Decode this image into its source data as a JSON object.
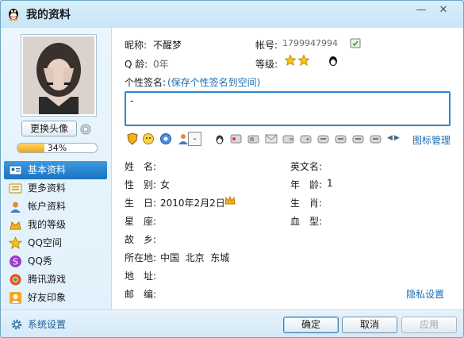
{
  "window": {
    "title": "我的资料",
    "minimize": "—",
    "close": "✕"
  },
  "avatar": {
    "change_label": "更换头像",
    "progress_percent": 34,
    "progress_label": "34%"
  },
  "nav": [
    {
      "label": "基本资料",
      "icon": "basic-profile-icon",
      "active": true
    },
    {
      "label": "更多资料",
      "icon": "more-profile-icon"
    },
    {
      "label": "帐户资料",
      "icon": "account-icon"
    },
    {
      "label": "我的等级",
      "icon": "level-icon"
    },
    {
      "label": "QQ空间",
      "icon": "qzone-icon"
    },
    {
      "label": "QQ秀",
      "icon": "qqshow-icon"
    },
    {
      "label": "腾讯游戏",
      "icon": "game-icon"
    },
    {
      "label": "好友印象",
      "icon": "impression-icon"
    }
  ],
  "profile": {
    "nickname_label": "昵称:",
    "nickname": "不醒梦",
    "account_label": "帐号:",
    "account": "1799947994",
    "qage_label": "Q 龄:",
    "qage": "0年",
    "level_label": "等级:",
    "signature_label": "个性签名:",
    "signature_link": "(保存个性签名到空间)",
    "signature_value": "-",
    "icon_manage": "图标管理",
    "tooltip": "-"
  },
  "details": {
    "name_label": "姓　名:",
    "name": "",
    "english_name_label": "英文名:",
    "english_name": "",
    "gender_label": "性　别:",
    "gender": "女",
    "age_label": "年　龄:",
    "age": "1",
    "birthday_label": "生　日:",
    "birthday": "2010年2月2日",
    "zodiac_label": "生　肖:",
    "zodiac": "",
    "constellation_label": "星　座:",
    "constellation": "",
    "blood_label": "血　型:",
    "blood": "",
    "hometown_label": "故　乡:",
    "hometown": "",
    "location_label": "所在地:",
    "location": "中国  北京  东城",
    "address_label": "地　址:",
    "address": "",
    "postcode_label": "邮　编:",
    "postcode": "",
    "privacy": "隐私设置"
  },
  "footer": {
    "settings": "系统设置",
    "ok": "确定",
    "cancel": "取消",
    "apply": "应用"
  },
  "colors": {
    "accent": "#1b73c2",
    "link": "#1b6db3",
    "progress": "#f3a415"
  }
}
